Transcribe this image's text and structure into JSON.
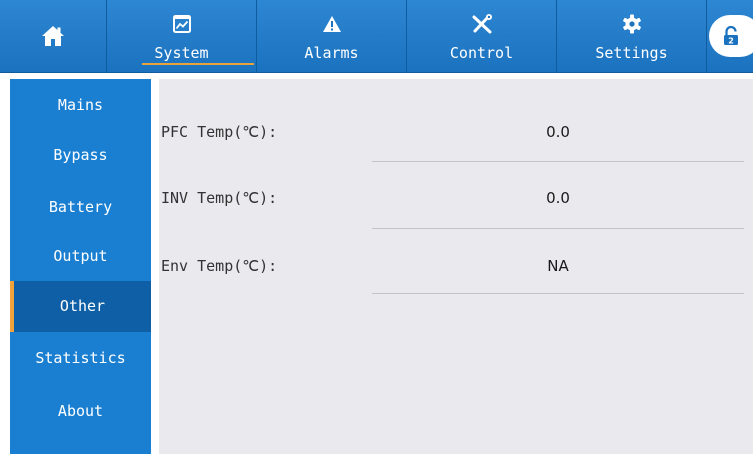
{
  "nav": {
    "tabs": [
      {
        "icon": "home-icon",
        "label": ""
      },
      {
        "icon": "chart-icon",
        "label": "System",
        "active": true
      },
      {
        "icon": "alarm-icon",
        "label": "Alarms"
      },
      {
        "icon": "tools-icon",
        "label": "Control"
      },
      {
        "icon": "gear-icon",
        "label": "Settings"
      }
    ],
    "lock": {
      "icon": "lock-icon",
      "level": "2"
    }
  },
  "sidebar": {
    "items": [
      {
        "label": "Mains"
      },
      {
        "label": "Bypass"
      },
      {
        "label": "Battery"
      },
      {
        "label": "Output"
      },
      {
        "label": "Other",
        "active": true
      },
      {
        "label": "Statistics"
      },
      {
        "label": "About"
      }
    ]
  },
  "main": {
    "rows": [
      {
        "label": "PFC Temp(℃):",
        "value": "0.0"
      },
      {
        "label": "INV Temp(℃):",
        "value": "0.0"
      },
      {
        "label": "Env Temp(℃):",
        "value": "NA"
      }
    ]
  },
  "colors": {
    "nav_bar": "#1b72bf",
    "sidebar": "#1b7fd1",
    "sidebar_active": "#0f5fa7",
    "accent": "#f2a23a",
    "content_bg": "#e9e9ee"
  }
}
